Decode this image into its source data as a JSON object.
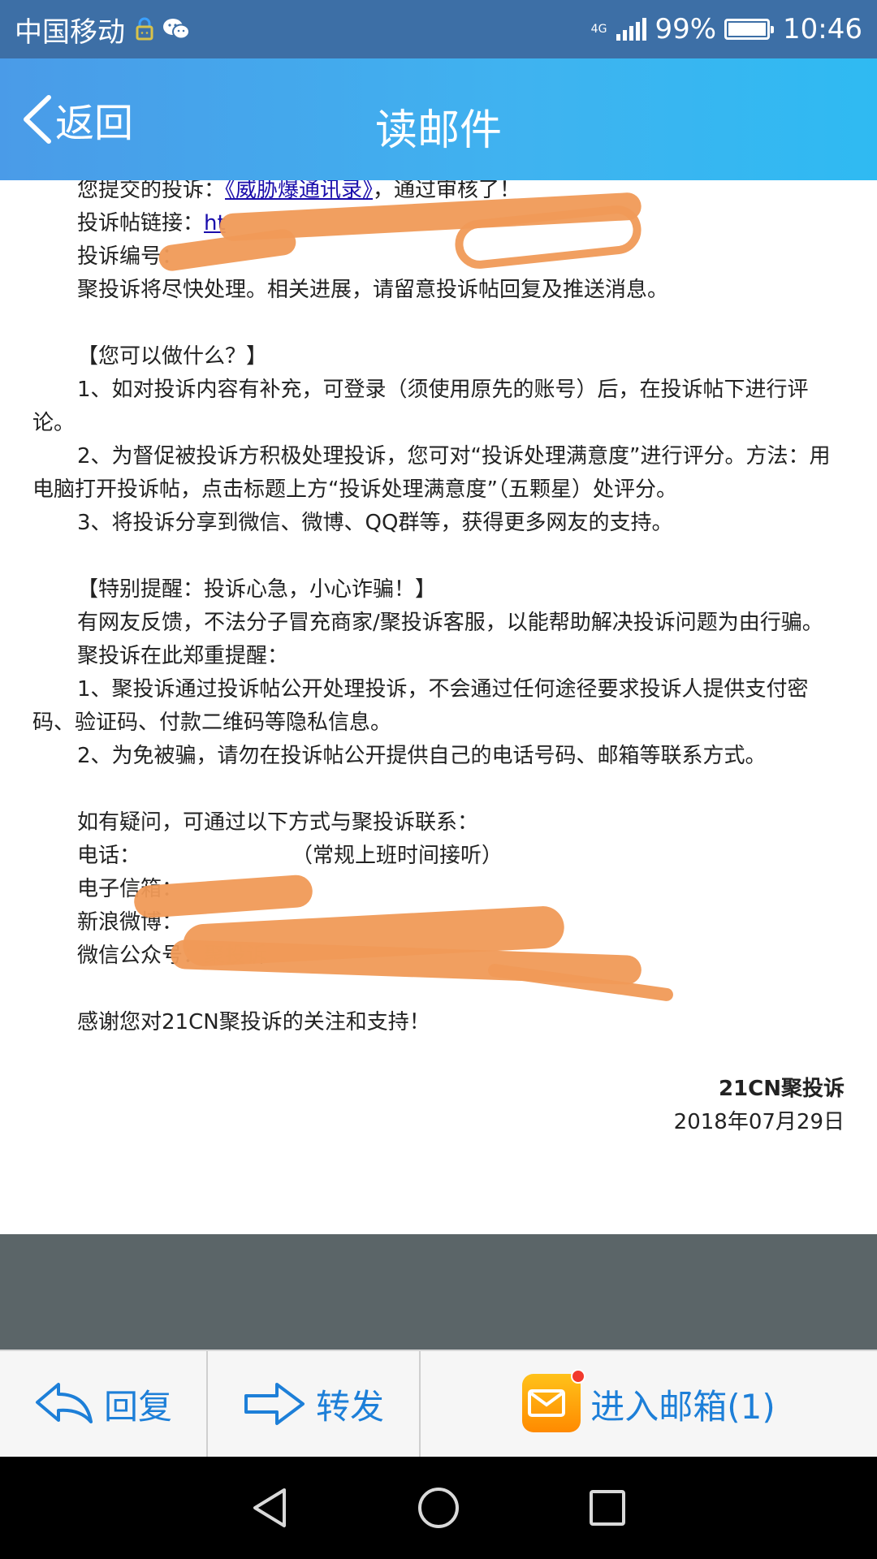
{
  "status_bar": {
    "carrier": "中国移动",
    "network": "4G",
    "battery": "99%",
    "time": "10:46"
  },
  "header": {
    "back_label": "返回",
    "title": "读邮件"
  },
  "email": {
    "line1_prefix": "您提交的投诉：",
    "line1_link": "《威胁爆通讯录》",
    "line1_suffix": "，通过审核了！",
    "link_label": "投诉帖链接：",
    "link_value": "ht",
    "id_label": "投诉编号：",
    "processing": "聚投诉将尽快处理。相关进展，请留意投诉帖回复及推送消息。",
    "section1_title": "【您可以做什么？】",
    "item1": "1、如对投诉内容有补充，可登录（须使用原先的账号）后，在投诉帖下进行评论。",
    "item2": "2、为督促被投诉方积极处理投诉，您可对“投诉处理满意度”进行评分。方法：用电脑打开投诉帖，点击标题上方“投诉处理满意度”（五颗星）处评分。",
    "item3": "3、将投诉分享到微信、微博、QQ群等，获得更多网友的支持。",
    "section2_title": "【特别提醒：投诉心急，小心诈骗！】",
    "warning": "有网友反馈，不法分子冒充商家/聚投诉客服，以能帮助解决投诉问题为由行骗。",
    "reminder": "聚投诉在此郑重提醒：",
    "reminder1": "1、聚投诉通过投诉帖公开处理投诉，不会通过任何途径要求投诉人提供支付密码、验证码、付款二维码等隐私信息。",
    "reminder2": "2、为免被骗，请勿在投诉帖公开提供自己的电话号码、邮箱等联系方式。",
    "contact_intro": "如有疑问，可通过以下方式与聚投诉联系：",
    "phone_label": "电话：",
    "phone_note": "（常规上班时间接听）",
    "email_label": "电子信箱：",
    "weibo_label": "新浪微博：",
    "wechat": "微信公众号：聚投诉",
    "thanks": "感谢您对21CN聚投诉的关注和支持！",
    "sign_org": "21CN聚投诉",
    "sign_date": "2018年07月29日"
  },
  "actions": {
    "reply": "回复",
    "forward": "转发",
    "inbox": "进入邮箱(1)"
  },
  "colors": {
    "status_bar": "#3d6fa6",
    "header_start": "#4a9be8",
    "header_end": "#2fbaf2",
    "accent": "#1d7fd8",
    "redaction": "#f09a57"
  }
}
